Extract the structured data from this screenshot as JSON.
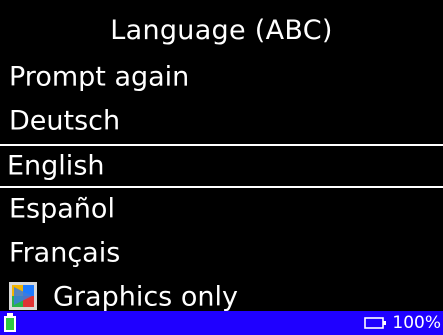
{
  "header": {
    "title": "Language (ABC)"
  },
  "menu": {
    "items": [
      {
        "label": "Prompt again",
        "selected": false
      },
      {
        "label": "Deutsch",
        "selected": false
      },
      {
        "label": "English",
        "selected": true
      },
      {
        "label": "Español",
        "selected": false
      },
      {
        "label": "Français",
        "selected": false
      },
      {
        "label": "Graphics only",
        "selected": false,
        "icon": "graphics-only-icon"
      }
    ]
  },
  "status_bar": {
    "level_text": "100%",
    "left_icon": "battery-icon",
    "right_icon": "display-icon"
  },
  "colors": {
    "background": "#000000",
    "text": "#ffffff",
    "status_bar": "#1f00ff",
    "battery_green": "#2ecc40"
  }
}
